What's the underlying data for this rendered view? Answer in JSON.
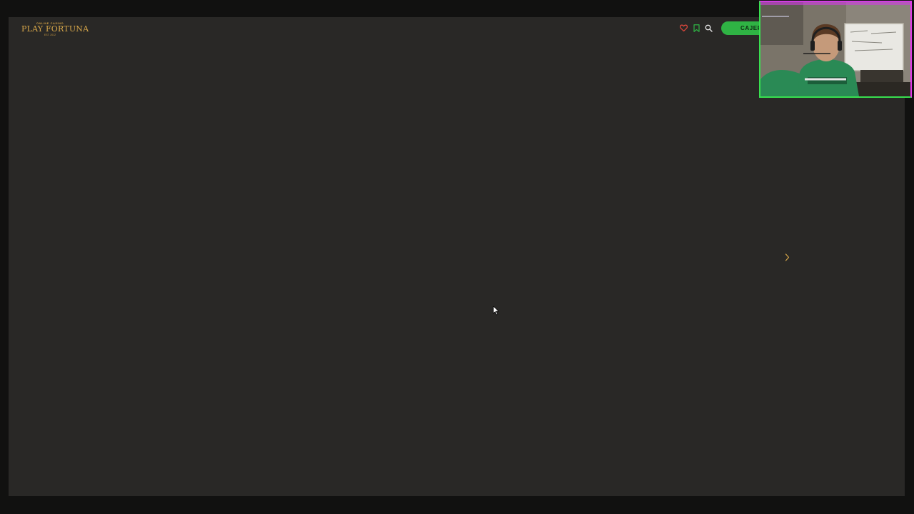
{
  "header": {
    "logo": {
      "tagline": "ONLINE CASINO",
      "name": "PLAY FORTUNA",
      "est": "EST. 2012"
    },
    "favorites_icon": "heart-icon",
    "bookmark_icon": "bookmark-icon",
    "search_icon": "search-icon",
    "cashier_label": "CAJER"
  },
  "carousel": {
    "next_icon": "chevron-right-icon"
  },
  "colors": {
    "page_background": "#292826",
    "outer_background": "#111110",
    "accent_gold": "#d7a74a",
    "cashier_green": "#2fb344",
    "heart_red": "#e0473c",
    "bookmark_green": "#2fb344"
  }
}
